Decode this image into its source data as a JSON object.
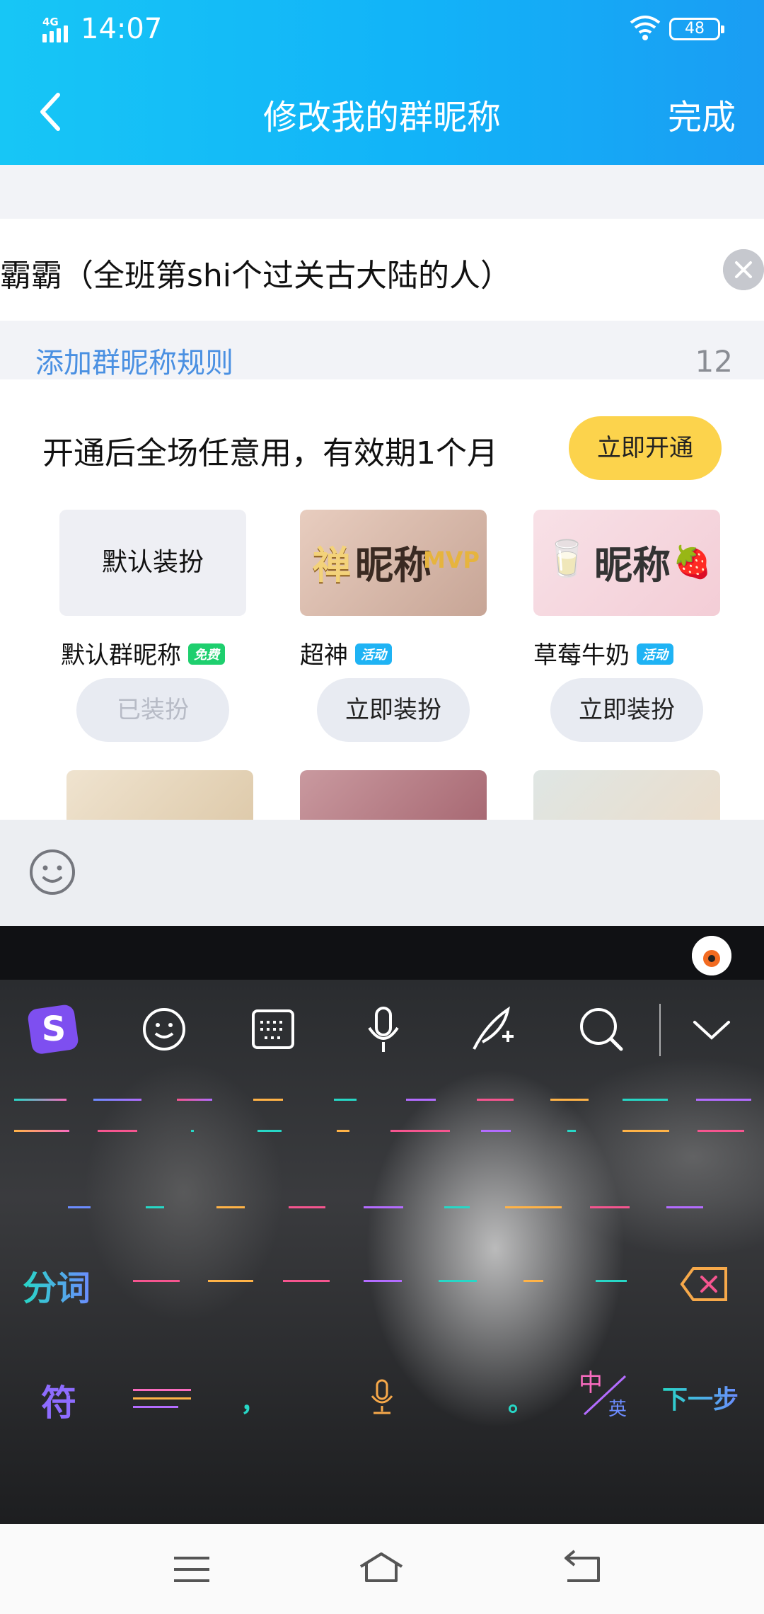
{
  "status_bar": {
    "network": "4G",
    "time": "14:07",
    "battery": "48"
  },
  "header": {
    "title": "修改我的群昵称",
    "done_label": "完成"
  },
  "input": {
    "value": "霸霸（全班第shi个过关古大陆的人）"
  },
  "add_rule_link": "添加群昵称规则",
  "char_count": "12",
  "promo": {
    "text": "开通后全场任意用，有效期1个月",
    "button_label": "立即开通"
  },
  "styles": [
    {
      "preview": "默认装扮",
      "name": "默认群昵称",
      "badge": "免费",
      "badge_color": "#1ecf6e",
      "action": "已装扮"
    },
    {
      "preview": "昵称",
      "name": "超神",
      "badge": "活动",
      "badge_color": "#1fb3f4",
      "action": "立即装扮"
    },
    {
      "preview": "昵称",
      "name": "草莓牛奶",
      "badge": "活动",
      "badge_color": "#1fb3f4",
      "action": "立即装扮"
    }
  ],
  "keyboard": {
    "toolbar_icons": [
      "sogou-logo-icon",
      "emoji-icon",
      "keyboard-layout-icon",
      "microphone-icon",
      "handwriting-icon",
      "search-icon",
      "collapse-chevron-icon"
    ],
    "keys": {
      "segment": "分词",
      "symbols": "符",
      "comma": "，",
      "period": "。",
      "lang_zh": "中",
      "lang_en": "英",
      "next": "下一步"
    }
  },
  "nav": {
    "icons": [
      "menu-icon",
      "home-icon",
      "back-icon"
    ]
  }
}
